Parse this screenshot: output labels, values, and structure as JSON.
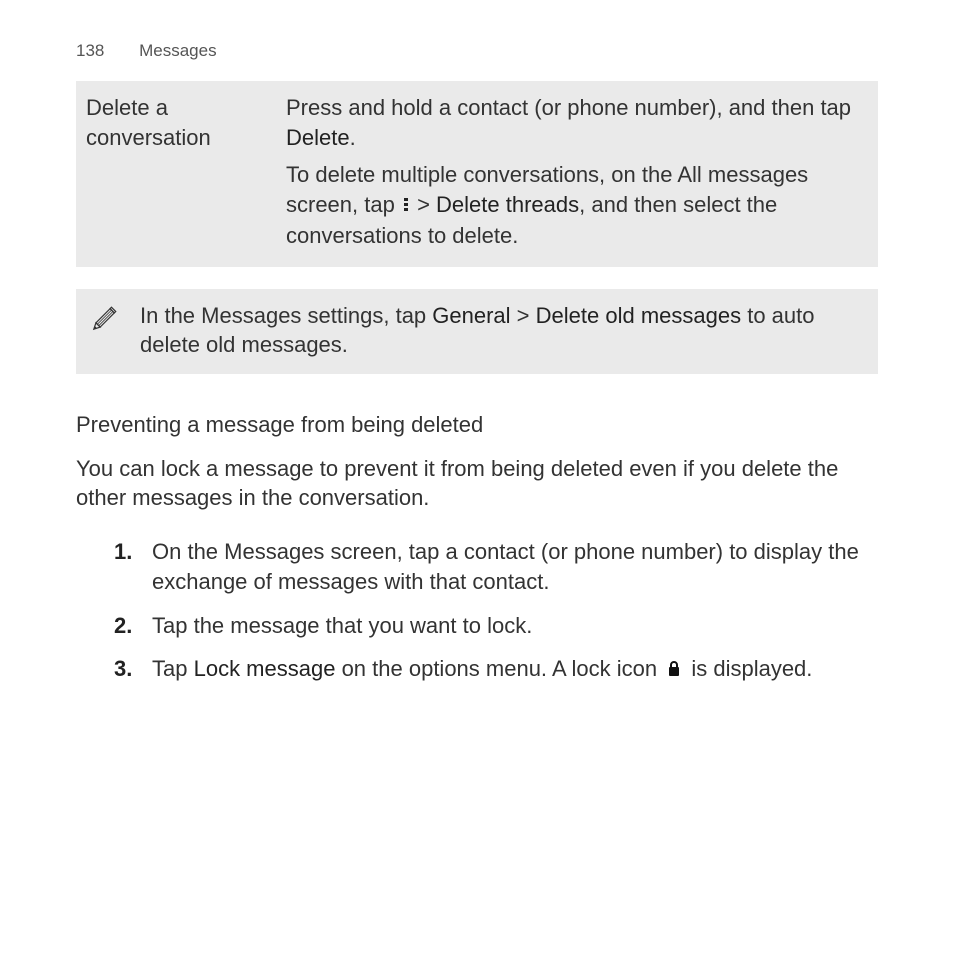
{
  "header": {
    "pageNumber": "138",
    "section": "Messages"
  },
  "table": {
    "left": "Delete a conversation",
    "right": {
      "p1_pre": "Press and hold a contact (or phone number), and then tap ",
      "p1_bold": "Delete",
      "p1_post": ".",
      "p2_pre": "To delete multiple conversations, on the All messages screen, tap ",
      "p2_sep": " > ",
      "p2_bold": "Delete threads",
      "p2_post": ", and then select the conversations to delete."
    }
  },
  "tip": {
    "pre": "In the Messages settings, tap ",
    "bold1": "General",
    "mid": " > ",
    "bold2": "Delete old messages",
    "post": " to auto delete old messages."
  },
  "heading": "Preventing a message from being deleted",
  "body": "You can lock a message to prevent it from being deleted even if you delete the other messages in the conversation.",
  "steps": {
    "s1": "On the Messages screen, tap a contact (or phone number) to display the exchange of messages with that contact.",
    "s2": "Tap the message that you want to lock.",
    "s3_pre": "Tap ",
    "s3_bold": "Lock message",
    "s3_mid": " on the options menu. A lock icon ",
    "s3_post": " is displayed."
  }
}
